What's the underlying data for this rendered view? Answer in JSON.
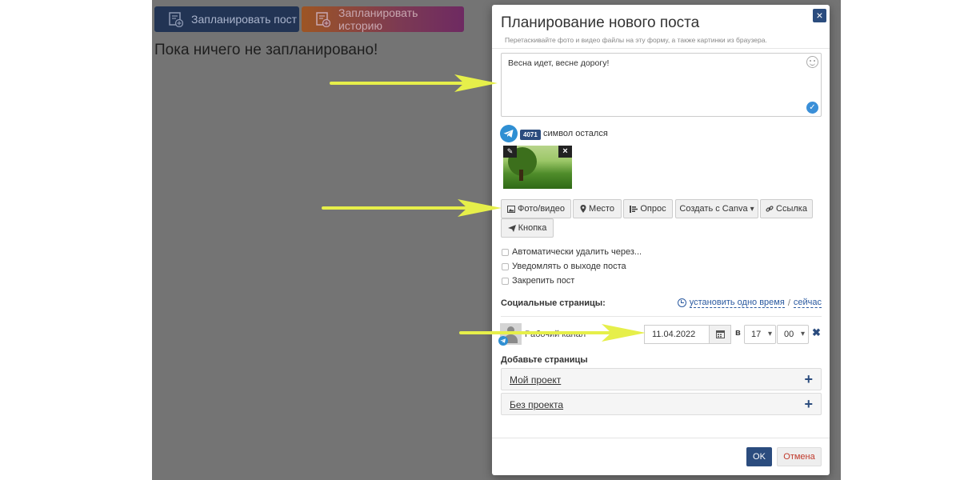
{
  "background": {
    "schedule_post_label": "Запланировать пост",
    "schedule_story_label": "Запланировать историю",
    "empty_message": "Пока ничего не запланировано!"
  },
  "modal": {
    "title": "Планирование нового поста",
    "close_symbol": "×",
    "hint": "Перетаскивайте фото и видео файлы на эту форму, а также картинки из браузера.",
    "post_text": "Весна идет, весне дорогу!",
    "chars_left_count": "4071",
    "chars_left_label": "символ остался",
    "toolbar": {
      "photo_video": "Фото/видео",
      "place": "Место",
      "poll": "Опрос",
      "canva": "Создать с Canva",
      "link": "Ссылка",
      "button": "Кнопка"
    },
    "options": [
      {
        "label": "Автоматически удалить через...",
        "checked": false
      },
      {
        "label": "Уведомлять о выходе поста",
        "checked": false
      },
      {
        "label": "Закрепить пост",
        "checked": false
      }
    ],
    "social_label": "Социальные страницы:",
    "set_one_time": "установить одно время",
    "separator": "/",
    "now": "сейчас",
    "channel": {
      "name": "Рабочий канал",
      "date": "11.04.2022",
      "at_label": "в",
      "hour": "17",
      "minute": "00"
    },
    "add_pages_label": "Добавьте страницы",
    "projects": [
      {
        "name": "Мой проект"
      },
      {
        "name": "Без проекта"
      }
    ],
    "ok_label": "OK",
    "cancel_label": "Отмена"
  },
  "colors": {
    "overlay": "#747474",
    "primary": "#2b4c7e",
    "cancel_text": "#c0392b",
    "arrow": "#e6ef4a"
  },
  "icons": [
    "calendar-plus-icon",
    "telegram-icon",
    "smiley-icon",
    "checkmark-icon",
    "pencil-icon",
    "image-icon",
    "map-marker-icon",
    "poll-icon",
    "link-icon",
    "send-icon",
    "clock-icon",
    "calendar-icon",
    "plus-icon",
    "close-icon"
  ]
}
